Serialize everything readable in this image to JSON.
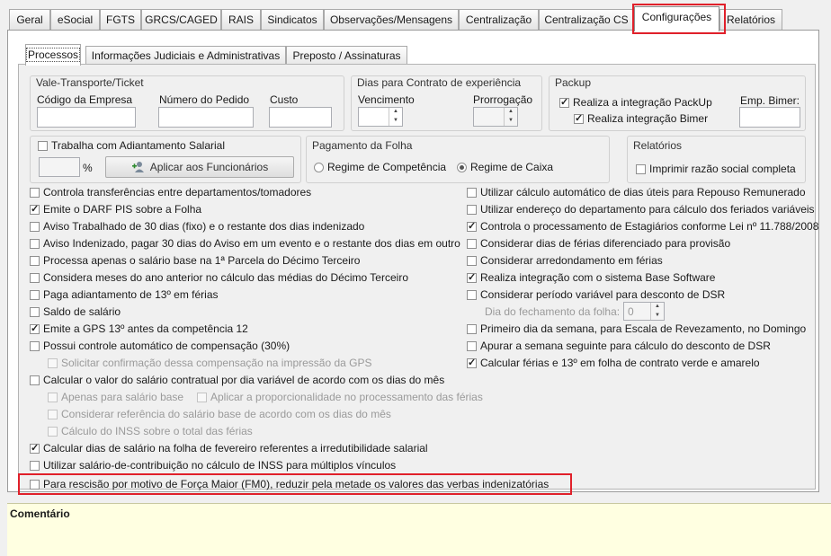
{
  "top_tabs": [
    "Geral",
    "eSocial",
    "FGTS",
    "GRCS/CAGED",
    "RAIS",
    "Sindicatos",
    "Observações/Mensagens",
    "Centralização",
    "Centralização CS",
    "Configurações",
    "Relatórios"
  ],
  "sub_tabs": [
    "Processos",
    "Informações Judiciais e Administrativas",
    "Preposto / Assinaturas"
  ],
  "vale": {
    "title": "Vale-Transporte/Ticket",
    "codigo": "Código da Empresa",
    "numero": "Número do Pedido",
    "custo": "Custo"
  },
  "dias": {
    "title": "Dias para Contrato de experiência",
    "vencimento": "Vencimento",
    "prorrogacao": "Prorrogação"
  },
  "packup": {
    "title": "Packup",
    "integracao": "Realiza a integração PackUp",
    "bimer": "Realiza integração Bimer",
    "emp": "Emp. Bimer:"
  },
  "adiant": {
    "label": "Trabalha com Adiantamento Salarial",
    "pct": "%",
    "button": "Aplicar aos Funcionários"
  },
  "pagamento": {
    "title": "Pagamento da Folha",
    "competencia": "Regime de Competência",
    "caixa": "Regime de Caixa"
  },
  "relatorios": {
    "title": "Relatórios",
    "imprimir": "Imprimir razão social completa"
  },
  "left_options": [
    "Controla transferências entre departamentos/tomadores",
    "Emite o DARF PIS sobre a Folha",
    "Aviso Trabalhado de 30 dias (fixo) e o restante dos dias indenizado",
    "Aviso Indenizado, pagar 30 dias do Aviso em um evento e o restante dos dias em outro",
    "Processa apenas o salário base na 1ª Parcela do Décimo Terceiro",
    "Considera meses do ano anterior no cálculo das médias do Décimo Terceiro",
    "Paga adiantamento de 13º em férias",
    "Saldo de salário",
    "Emite a GPS 13º antes da competência 12",
    "Possui controle automático de compensação (30%)",
    "Solicitar confirmação dessa compensação na impressão da GPS",
    "Calcular o valor do salário contratual por dia variável de acordo com os dias do mês",
    "Apenas para salário base",
    "Aplicar a proporcionalidade no processamento das férias",
    "Considerar referência do salário base de acordo com os dias do mês",
    "Cálculo do INSS sobre o total das férias",
    "Calcular dias de salário na folha de fevereiro referentes a irredutibilidade salarial",
    "Utilizar salário-de-contribuição no cálculo de INSS para múltiplos vínculos",
    "Para rescisão por motivo de Força Maior (FM0), reduzir pela metade os valores das verbas indenizatórias"
  ],
  "right_options": [
    "Utilizar cálculo automático de dias úteis para Repouso Remunerado",
    "Utilizar endereço do departamento para cálculo dos feriados variáveis",
    "Controla o processamento de Estagiários conforme Lei nº 11.788/2008",
    "Considerar dias de férias diferenciado para provisão",
    "Considerar arredondamento em férias",
    "Realiza integração com o sistema Base Software",
    "Considerar período variável para desconto de DSR",
    "Dia do fechamento da folha:",
    "Primeiro dia da semana, para Escala de Revezamento, no Domingo",
    "Apurar a semana seguinte para cálculo do desconto de DSR",
    "Calcular férias e 13º em folha de contrato verde e amarelo"
  ],
  "fechamento_value": "0",
  "comment_title": "Comentário",
  "colors": {
    "highlight": "#e0202a",
    "comment_bg": "#ffffe1"
  }
}
